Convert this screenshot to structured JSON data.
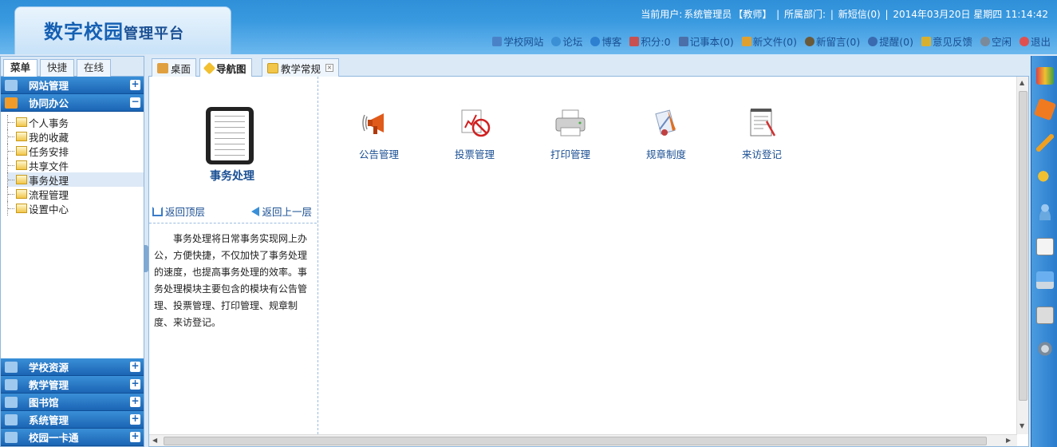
{
  "header": {
    "logo_main": "数字校园",
    "logo_sub": "管理平台",
    "user_info": {
      "current_user_label": "当前用户:",
      "user_name": "系统管理员",
      "role": "【教师】",
      "dept_label": "所属部门:",
      "messages": "新短信(0)",
      "datetime": "2014年03月20日 星期四 11:14:42"
    },
    "links": [
      {
        "label": "学校网站",
        "icon": "website-icon",
        "color": "#4a82c8"
      },
      {
        "label": "论坛",
        "icon": "forum-icon",
        "color": "#3b8fd4"
      },
      {
        "label": "博客",
        "icon": "blog-icon",
        "color": "#2d7fd0"
      },
      {
        "label": "积分:0",
        "icon": "points-icon",
        "color": "#c85050"
      },
      {
        "label": "记事本(0)",
        "icon": "notebook-icon",
        "color": "#4b6fa8"
      },
      {
        "label": "新文件(0)",
        "icon": "newfile-icon",
        "color": "#e0a030"
      },
      {
        "label": "新留言(0)",
        "icon": "message-icon",
        "color": "#6a5a3a"
      },
      {
        "label": "提醒(0)",
        "icon": "reminder-icon",
        "color": "#3a6ab0"
      },
      {
        "label": "意见反馈",
        "icon": "feedback-icon",
        "color": "#d8b030"
      },
      {
        "label": "空闲",
        "icon": "idle-icon",
        "color": "#7a8a9a"
      },
      {
        "label": "退出",
        "icon": "logout-icon",
        "color": "#e05050"
      }
    ]
  },
  "sidebar": {
    "tabs": [
      "菜单",
      "快捷",
      "在线"
    ],
    "groups_top": [
      {
        "label": "网站管理",
        "toggle": "+"
      },
      {
        "label": "协同办公",
        "toggle": "−"
      }
    ],
    "tree": [
      "个人事务",
      "我的收藏",
      "任务安排",
      "共享文件",
      "事务处理",
      "流程管理",
      "设置中心"
    ],
    "groups_bottom": [
      {
        "label": "学校资源",
        "toggle": "+"
      },
      {
        "label": "教学管理",
        "toggle": "+"
      },
      {
        "label": "图书馆",
        "toggle": "+"
      },
      {
        "label": "系统管理",
        "toggle": "+"
      },
      {
        "label": "校园一卡通",
        "toggle": "+"
      }
    ]
  },
  "main_tabs": [
    "桌面",
    "导航图",
    "教学常规"
  ],
  "main": {
    "title": "事务处理",
    "back_top": "返回顶层",
    "back_up": "返回上一层",
    "description": "事务处理将日常事务实现网上办公，方便快捷，不仅加快了事务处理的速度，也提高事务处理的效率。事务处理模块主要包含的模块有公告管理、投票管理、打印管理、规章制度、来访登记。",
    "apps": [
      {
        "label": "公告管理",
        "icon": "announcement-icon"
      },
      {
        "label": "投票管理",
        "icon": "vote-icon"
      },
      {
        "label": "打印管理",
        "icon": "printer-icon"
      },
      {
        "label": "规章制度",
        "icon": "rules-icon"
      },
      {
        "label": "来访登记",
        "icon": "visitor-register-icon"
      }
    ]
  }
}
